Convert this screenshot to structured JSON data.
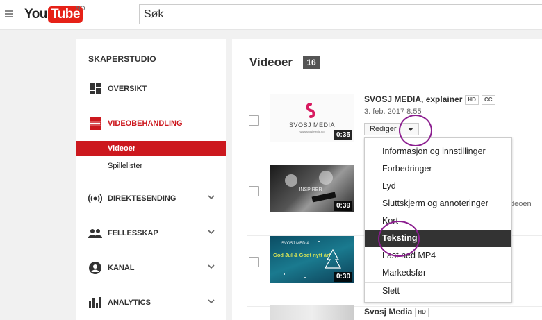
{
  "header": {
    "logo_you": "You",
    "logo_tube": "Tube",
    "country": "NO",
    "search_placeholder": "Søk",
    "search_text": "Søk"
  },
  "sidebar": {
    "title": "SKAPERSTUDIO",
    "items": [
      {
        "label": "OVERSIKT",
        "icon": "dashboard-icon"
      },
      {
        "label": "VIDEOBEHANDLING",
        "icon": "video-manager-icon"
      },
      {
        "label": "DIREKTESENDING",
        "icon": "live-broadcast-icon"
      },
      {
        "label": "FELLESSKAP",
        "icon": "community-icon"
      },
      {
        "label": "KANAL",
        "icon": "channel-icon"
      },
      {
        "label": "ANALYTICS",
        "icon": "analytics-icon"
      }
    ],
    "subitems": [
      {
        "label": "Videoer"
      },
      {
        "label": "Spillelister"
      }
    ]
  },
  "main": {
    "title": "Videoer",
    "count": "16",
    "videos": [
      {
        "title": "SVOSJ MEDIA, explainer",
        "tags": [
          "HD",
          "CC"
        ],
        "date": "3. feb. 2017 8:55",
        "duration": "0:35",
        "thumb_text": "SVOSJ MEDIA",
        "thumb_url": "www.svosjmedia.no"
      },
      {
        "title": "",
        "duration": "0:39",
        "thumb_text": "INSPIRER",
        "partial": "deoen"
      },
      {
        "title": "",
        "duration": "0:30",
        "thumb_text": "God Jul & Godt nytt år!"
      },
      {
        "title": "Svosj Media",
        "tags": [
          "HD"
        ]
      }
    ],
    "edit_button": "Rediger"
  },
  "dropdown": {
    "items": [
      {
        "label": "Informasjon og innstillinger"
      },
      {
        "label": "Forbedringer"
      },
      {
        "label": "Lyd"
      },
      {
        "label": "Sluttskjerm og annoteringer"
      },
      {
        "label": "Kort"
      },
      {
        "label": "Teksting"
      },
      {
        "label": "Last ned MP4"
      },
      {
        "label": "Markedsfør"
      },
      {
        "label": "Slett"
      }
    ]
  },
  "colors": {
    "accent": "#cc181e",
    "highlight_circle": "#8b1d8f"
  }
}
